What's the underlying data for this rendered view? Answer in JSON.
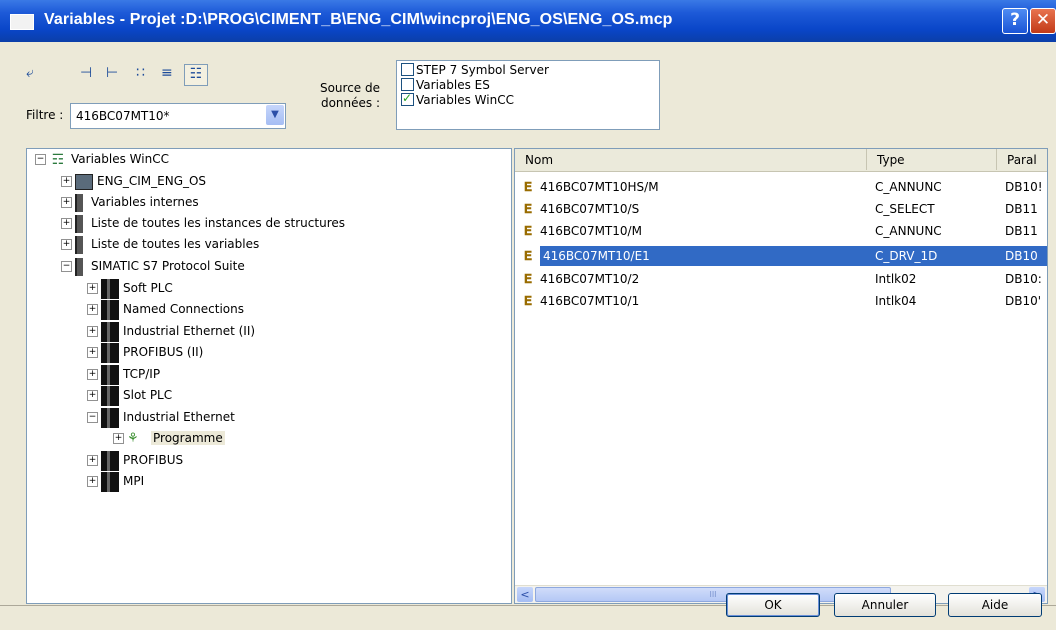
{
  "window": {
    "title": "Variables - Projet :D:\\PROG\\CIMENT_B\\ENG_CIM\\wincproj\\ENG_OS\\ENG_OS.mcp",
    "help_glyph": "?",
    "close_glyph": "✕"
  },
  "toolbar": {
    "icons": [
      "up-folder-icon",
      "import-icon",
      "export-icon",
      "tree-view-icon",
      "list-view-icon",
      "details-view-icon"
    ]
  },
  "filter": {
    "label": "Filtre :",
    "value": "416BC07MT10*"
  },
  "source": {
    "label_line1": "Source de",
    "label_line2": "données :",
    "options": [
      {
        "label": "STEP 7 Symbol Server",
        "checked": false
      },
      {
        "label": "Variables ES",
        "checked": false
      },
      {
        "label": "Variables WinCC",
        "checked": true
      }
    ]
  },
  "tree": {
    "nodes": [
      {
        "label": "Variables WinCC",
        "expander": "−"
      },
      {
        "label": "ENG_CIM_ENG_OS",
        "expander": "+"
      },
      {
        "label": "Variables internes",
        "expander": "+"
      },
      {
        "label": "Liste de toutes les instances de structures",
        "expander": "+"
      },
      {
        "label": "Liste de toutes les variables",
        "expander": "+"
      },
      {
        "label": "SIMATIC S7 Protocol Suite",
        "expander": "−"
      },
      {
        "label": "Soft PLC",
        "expander": "+"
      },
      {
        "label": "Named Connections",
        "expander": "+"
      },
      {
        "label": "Industrial Ethernet (II)",
        "expander": "+"
      },
      {
        "label": "PROFIBUS (II)",
        "expander": "+"
      },
      {
        "label": "TCP/IP",
        "expander": "+"
      },
      {
        "label": "Slot PLC",
        "expander": "+"
      },
      {
        "label": "Industrial Ethernet",
        "expander": "−"
      },
      {
        "label": "Programme",
        "expander": "+"
      },
      {
        "label": "PROFIBUS",
        "expander": "+"
      },
      {
        "label": "MPI",
        "expander": "+"
      }
    ]
  },
  "list": {
    "columns": [
      "Nom",
      "Type",
      "Paral"
    ],
    "rows": [
      {
        "name": "416BC07MT10HS/M",
        "type": "C_ANNUNC",
        "param": "DB10!"
      },
      {
        "name": "416BC07MT10/S",
        "type": "C_SELECT",
        "param": "DB11"
      },
      {
        "name": "416BC07MT10/M",
        "type": "C_ANNUNC",
        "param": "DB11"
      },
      {
        "name": "416BC07MT10/E1",
        "type": "C_DRV_1D",
        "param": "DB10",
        "selected": true
      },
      {
        "name": "416BC07MT10/2",
        "type": "Intlk02",
        "param": "DB10:"
      },
      {
        "name": "416BC07MT10/1",
        "type": "Intlk04",
        "param": "DB10'"
      }
    ],
    "scroll_left": "<",
    "scroll_right": ">",
    "thumb_grip": "III"
  },
  "buttons": {
    "ok": "OK",
    "cancel": "Annuler",
    "help": "Aide"
  },
  "colors": {
    "title_bar": "#0a46c8",
    "selection": "#316ac5",
    "dialog_bg": "#ece9d8"
  }
}
